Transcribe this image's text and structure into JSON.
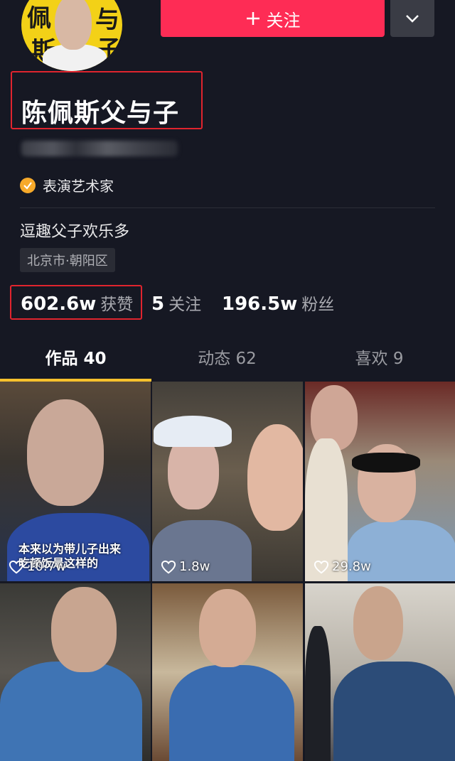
{
  "header": {
    "follow_label": "关注",
    "follow_icon": "plus-icon",
    "more_icon": "chevron-down-icon",
    "avatar_chars": [
      "佩",
      "斯",
      "与",
      "子"
    ]
  },
  "profile": {
    "name": "陈佩斯父与子",
    "verified_label": "表演艺术家",
    "bio": "逗趣父子欢乐多",
    "location": "北京市·朝阳区"
  },
  "stats": {
    "likes": {
      "value": "602.6w",
      "label": "获赞"
    },
    "following": {
      "value": "5",
      "label": "关注"
    },
    "followers": {
      "value": "196.5w",
      "label": "粉丝"
    }
  },
  "tabs": [
    {
      "label": "作品 40"
    },
    {
      "label": "动态 62"
    },
    {
      "label": "喜欢 9"
    }
  ],
  "videos": [
    {
      "likes": "10.7w",
      "caption": "本来以为带儿子出来\n吃顿饭是这样的"
    },
    {
      "likes": "1.8w"
    },
    {
      "likes": "29.8w"
    },
    {},
    {},
    {}
  ],
  "colors": {
    "background": "#161823",
    "accent": "#fe2c55",
    "tab_indicator": "#f6c12d",
    "highlight_box": "#e0242e"
  }
}
